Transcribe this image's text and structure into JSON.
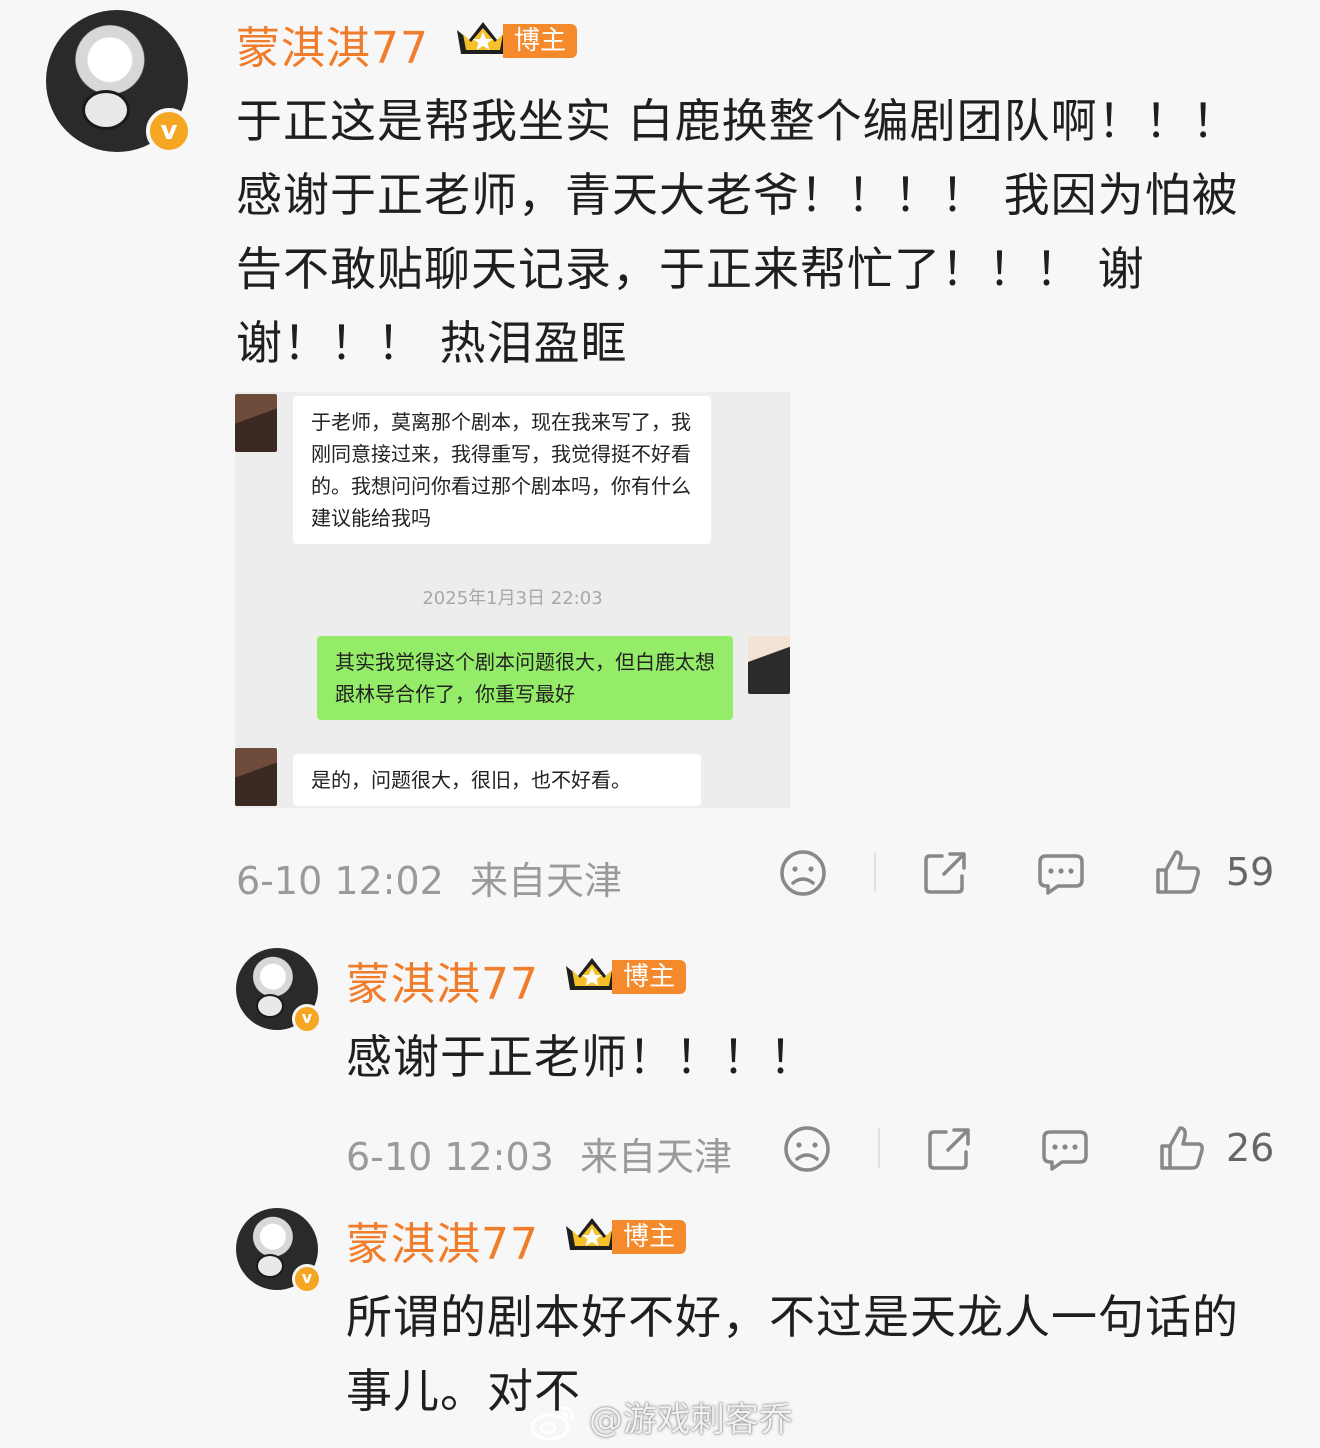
{
  "comments": [
    {
      "username": "蒙淇淇77",
      "badge": "博主",
      "verified_mark": "v",
      "text": "于正这是帮我坐实 白鹿换整个编剧团队啊！！！感谢于正老师，青天大老爷！！！！ 我因为怕被告不敢贴聊天记录，于正来帮忙了！！！ 谢谢！！！ 热泪盈眶",
      "time": "6-10 12:02",
      "location": "来自天津",
      "likes": "59"
    },
    {
      "username": "蒙淇淇77",
      "badge": "博主",
      "verified_mark": "v",
      "text": "感谢于正老师！！！！",
      "time": "6-10 12:03",
      "location": "来自天津",
      "likes": "26"
    },
    {
      "username": "蒙淇淇77",
      "badge": "博主",
      "verified_mark": "v",
      "text": "所谓的剧本好不好，不过是天龙人一句话的事儿。对不"
    }
  ],
  "chat": {
    "msg1": "于老师，莫离那个剧本，现在我来写了，我刚同意接过来，我得重写，我觉得挺不好看的。我想问问你看过那个剧本吗，你有什么建议能给我吗",
    "time": "2025年1月3日 22:03",
    "msg2": "其实我觉得这个剧本问题很大，但白鹿太想跟林导合作了，你重写最好",
    "msg3": "是的，问题很大，很旧，也不好看。"
  },
  "watermark": "@游戏刺客乔",
  "colors": {
    "username": "#ef7d2b",
    "badge": "#f58a2d",
    "green_bubble": "#95ec69",
    "meta": "#9a9a9a"
  }
}
